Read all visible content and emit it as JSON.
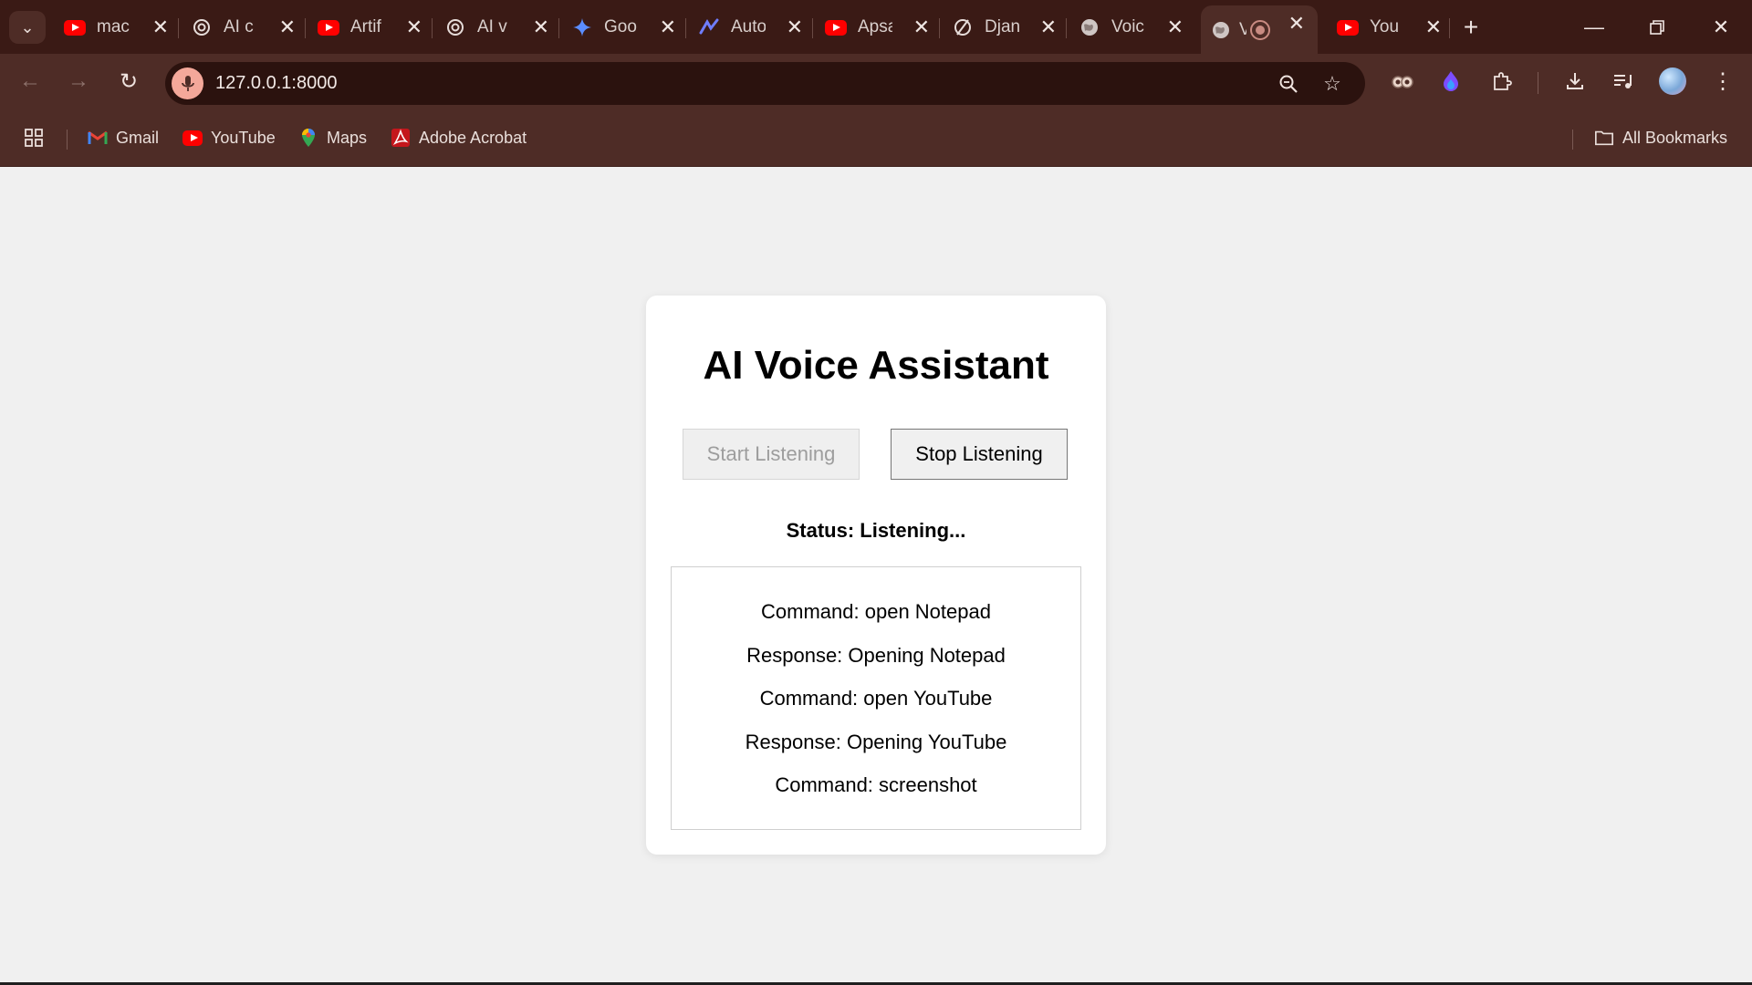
{
  "browser": {
    "tabs": [
      {
        "title": "mac",
        "icon": "youtube-icon"
      },
      {
        "title": "AI c",
        "icon": "openai-icon"
      },
      {
        "title": "Artif",
        "icon": "youtube-icon"
      },
      {
        "title": "AI v",
        "icon": "openai-icon"
      },
      {
        "title": "Goo",
        "icon": "gemini-icon"
      },
      {
        "title": "Auto",
        "icon": "tool-icon"
      },
      {
        "title": "Apsa",
        "icon": "youtube-icon"
      },
      {
        "title": "Djan",
        "icon": "django-icon"
      },
      {
        "title": "Voic",
        "icon": "globe-icon"
      },
      {
        "title": "V",
        "icon": "globe-icon",
        "active": true,
        "recording": true
      },
      {
        "title": "You",
        "icon": "youtube-icon"
      }
    ],
    "url": "127.0.0.1:8000",
    "bookmarks": [
      {
        "label": "Gmail",
        "icon": "gmail-icon"
      },
      {
        "label": "YouTube",
        "icon": "youtube-icon"
      },
      {
        "label": "Maps",
        "icon": "maps-icon"
      },
      {
        "label": "Adobe Acrobat",
        "icon": "acrobat-icon"
      }
    ],
    "all_bookmarks_label": "All Bookmarks",
    "colors": {
      "frame": "#3a1a15",
      "toolbar": "#4e2c26",
      "omnibox": "#2b120e"
    }
  },
  "app": {
    "title": "AI Voice Assistant",
    "start_label": "Start Listening",
    "stop_label": "Stop Listening",
    "status": "Status: Listening...",
    "log": [
      "Command: open Notepad",
      "Response: Opening Notepad",
      "Command: open YouTube",
      "Response: Opening YouTube",
      "Command: screenshot"
    ]
  }
}
